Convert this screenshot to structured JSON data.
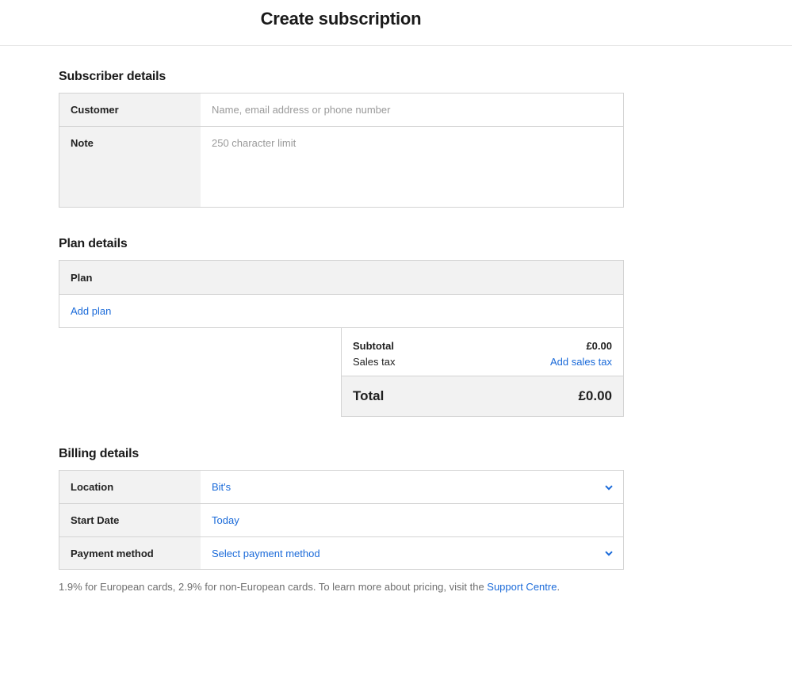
{
  "header": {
    "title": "Create subscription"
  },
  "subscriber": {
    "title": "Subscriber details",
    "customer_label": "Customer",
    "customer_placeholder": "Name, email address or phone number",
    "note_label": "Note",
    "note_placeholder": "250 character limit"
  },
  "plan": {
    "title": "Plan details",
    "header_label": "Plan",
    "add_plan": "Add plan",
    "subtotal_label": "Subtotal",
    "subtotal_value": "£0.00",
    "sales_tax_label": "Sales tax",
    "add_sales_tax": "Add sales tax",
    "total_label": "Total",
    "total_value": "£0.00"
  },
  "billing": {
    "title": "Billing details",
    "location_label": "Location",
    "location_value": "Bit's",
    "start_date_label": "Start Date",
    "start_date_value": "Today",
    "payment_label": "Payment method",
    "payment_value": "Select payment method"
  },
  "footnote": {
    "text": "1.9% for European cards, 2.9% for non-European cards. To learn more about pricing, visit the ",
    "link": "Support Centre",
    "end": "."
  },
  "icons": {
    "dropdown": "chevron-down-icon"
  },
  "colors": {
    "link": "#1a6ad9",
    "label_bg": "#f2f2f2",
    "border": "#d3d3d3"
  }
}
